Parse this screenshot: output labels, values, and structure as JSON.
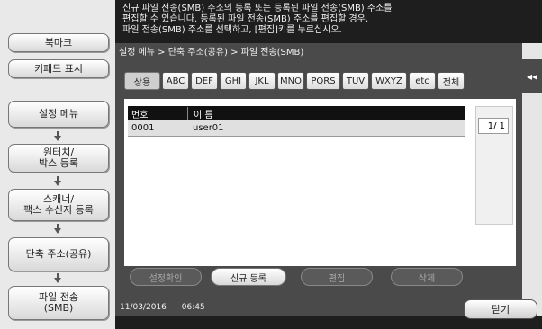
{
  "message": "신규 파일 전송(SMB) 주소의 등록 또는 등록된 파일 전송(SMB) 주소를\n편집할 수 있습니다. 등록된 파일 전송(SMB) 주소를 편집할 경우,\n파일 전송(SMB) 주소를 선택하고, [편집]키를 누르십시오.",
  "left": {
    "bookmark": "북마크",
    "keypad": "키패드 표시",
    "steps": [
      "설정 메뉴",
      "원터치/\n박스 등록",
      "스캐너/\n팩스 수신지 등록",
      "단축 주소(공유)",
      "파일 전송\n(SMB)"
    ]
  },
  "breadcrumb": "설정 메뉴 > 단축 주소(공유) > 파일 전송(SMB)",
  "tabs": [
    "상용",
    "ABC",
    "DEF",
    "GHI",
    "JKL",
    "MNO",
    "PQRS",
    "TUV",
    "WXYZ",
    "etc",
    "전체"
  ],
  "selected_tab": "상용",
  "table": {
    "headers": [
      "번호",
      "이 름"
    ],
    "rows": [
      {
        "number": "0001",
        "name": "user01"
      }
    ]
  },
  "page_indicator": "1/  1",
  "buttons": {
    "confirm": "설정확인",
    "new": "신규 등록",
    "edit": "편집",
    "delete": "삭제",
    "close": "닫기"
  },
  "datetime": {
    "date": "11/03/2016",
    "time": "06:45"
  },
  "collapse_glyph": "◂◂",
  "icons": {
    "collapse": "double-left-chevron-icon",
    "arrow": "down-arrow-icon"
  }
}
